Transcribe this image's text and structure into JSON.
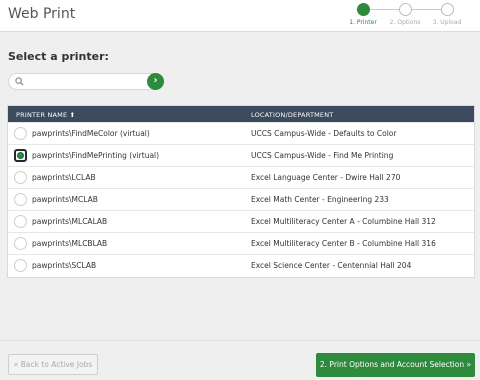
{
  "app": {
    "title": "Web Print"
  },
  "steps": [
    {
      "label": "1. Printer",
      "active": true
    },
    {
      "label": "2. Options",
      "active": false
    },
    {
      "label": "3. Upload",
      "active": false
    }
  ],
  "main": {
    "heading": "Select a printer:",
    "search": {
      "value": "",
      "placeholder": "",
      "go_label": "›"
    }
  },
  "table": {
    "columns": [
      "PRINTER NAME ⬆",
      "LOCATION/DEPARTMENT"
    ],
    "rows": [
      {
        "name": "pawprints\\FindMeColor (virtual)",
        "location": "UCCS Campus-Wide - Defaults to Color"
      },
      {
        "name": "pawprints\\FindMePrinting (virtual)",
        "location": "UCCS Campus-Wide - Find Me Printing"
      },
      {
        "name": "pawprints\\LCLAB",
        "location": "Excel Language Center - Dwire Hall 270"
      },
      {
        "name": "pawprints\\MCLAB",
        "location": "Excel Math Center - Engineering 233"
      },
      {
        "name": "pawprints\\MLCALAB",
        "location": "Excel Multiliteracy Center A - Columbine Hall 312"
      },
      {
        "name": "pawprints\\MLCBLAB",
        "location": "Excel Multiliteracy Center B - Columbine Hall 316"
      },
      {
        "name": "pawprints\\SCLAB",
        "location": "Excel Science Center - Centennial Hall 204"
      }
    ]
  },
  "footer": {
    "back_label": "« Back to Active Jobs",
    "next_label": "2. Print Options and Account Selection »"
  },
  "colors": {
    "accent": "#2e8b3d",
    "header_bg": "#3b4a5c"
  }
}
